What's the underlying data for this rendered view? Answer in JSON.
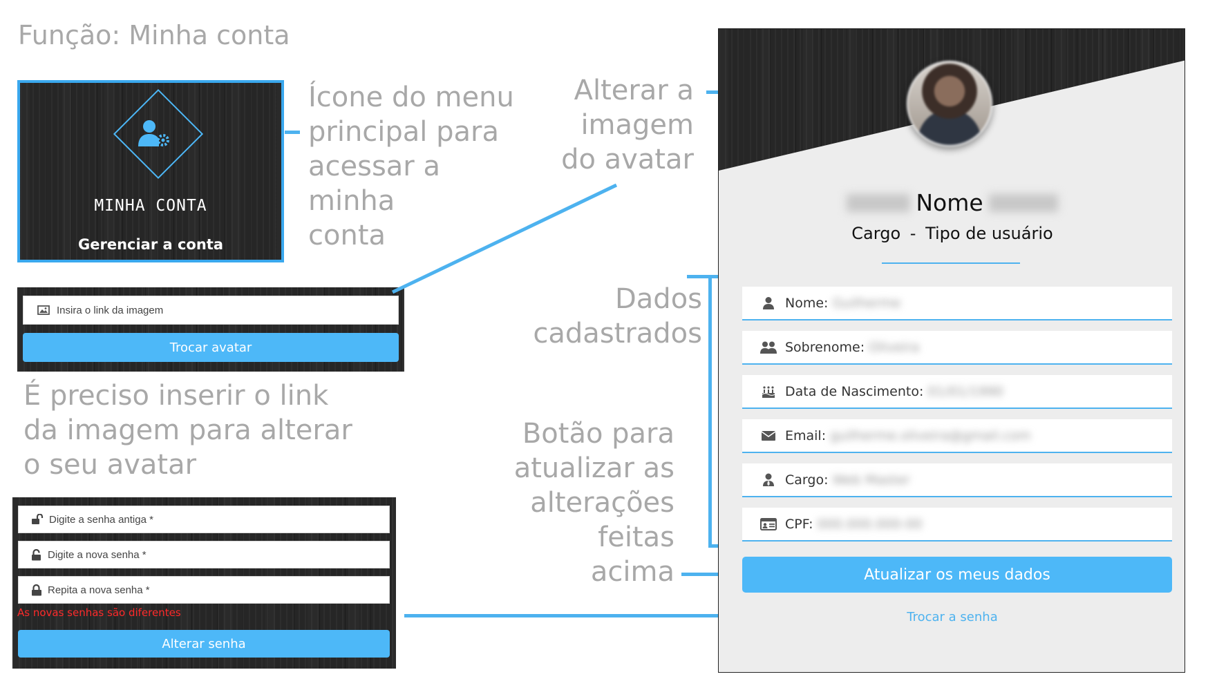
{
  "page_title": "Função: Minha conta",
  "menu_tile": {
    "title": "MINHA CONTA",
    "subtitle": "Gerenciar a conta",
    "icon": "user-gear-icon"
  },
  "annotations": {
    "menu_icon": [
      "Ícone do menu",
      "principal para",
      "acessar a",
      "minha",
      "conta"
    ],
    "change_avatar": [
      "Alterar a",
      "imagem",
      "do avatar"
    ],
    "insert_link": [
      "É preciso inserir o link",
      "da imagem para alterar",
      "o seu avatar"
    ],
    "registered_data": [
      "Dados",
      "cadastrados"
    ],
    "update_button": [
      "Botão para",
      "atualizar as",
      "alterações",
      "feitas",
      "acima"
    ]
  },
  "avatar_form": {
    "placeholder": "Insira o link da imagem",
    "button": "Trocar avatar"
  },
  "password_form": {
    "old_password_placeholder": "Digite a senha antiga *",
    "new_password_placeholder": "Digite a nova senha *",
    "repeat_password_placeholder": "Repita a nova senha *",
    "error": "As novas senhas são diferentes",
    "button": "Alterar senha"
  },
  "profile": {
    "name": "Nome",
    "role": "Cargo",
    "separator": "-",
    "user_type": "Tipo de usuário",
    "fields": [
      {
        "label": "Nome:",
        "icon": "user-icon",
        "value": "Guilherme"
      },
      {
        "label": "Sobrenome:",
        "icon": "users-icon",
        "value": "Oliveira"
      },
      {
        "label": "Data de Nascimento:",
        "icon": "birthday-cake-icon",
        "value": "01/01/1990"
      },
      {
        "label": "Email:",
        "icon": "envelope-icon",
        "value": "guilherme.oliveira@gmail.com"
      },
      {
        "label": "Cargo:",
        "icon": "user-tie-icon",
        "value": "Web Master"
      },
      {
        "label": "CPF:",
        "icon": "id-card-icon",
        "value": "000.000.000-00"
      }
    ],
    "update_button": "Atualizar os meus dados",
    "change_password_link": "Trocar a senha"
  },
  "colors": {
    "accent": "#4db8f8",
    "annotation_text": "#a8a8a8",
    "error": "#ff2a2a",
    "dark_bg": "#262626"
  }
}
